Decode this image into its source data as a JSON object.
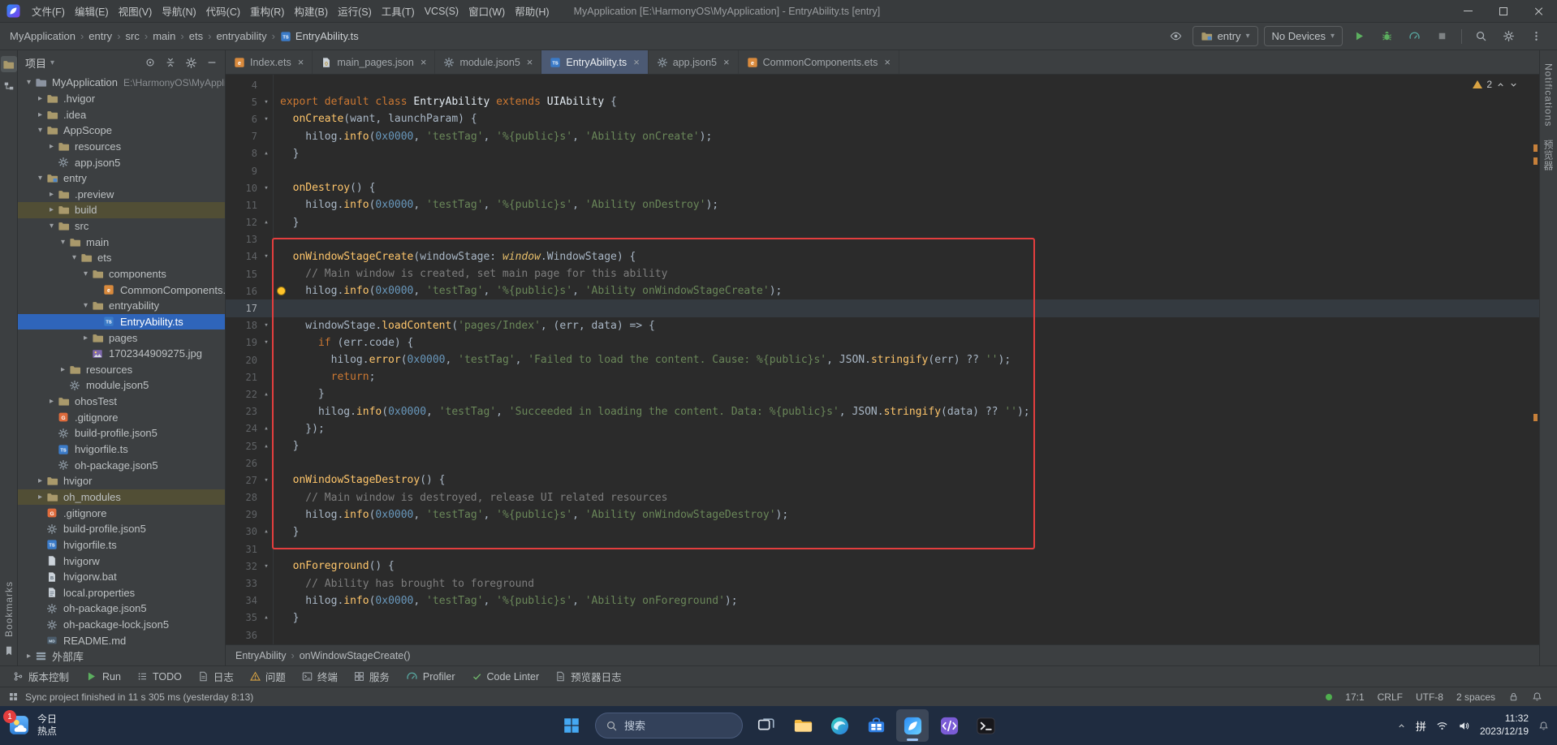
{
  "window": {
    "title": "MyApplication [E:\\HarmonyOS\\MyApplication] - EntryAbility.ts [entry]",
    "menus": [
      "文件(F)",
      "编辑(E)",
      "视图(V)",
      "导航(N)",
      "代码(C)",
      "重构(R)",
      "构建(B)",
      "运行(S)",
      "工具(T)",
      "VCS(S)",
      "窗口(W)",
      "帮助(H)"
    ]
  },
  "toolbar": {
    "breadcrumbs": [
      "MyApplication",
      "entry",
      "src",
      "main",
      "ets",
      "entryability",
      "EntryAbility.ts"
    ],
    "run_config": "entry",
    "device": "No Devices"
  },
  "project_panel": {
    "header": "项目",
    "tree": [
      {
        "level": 0,
        "chevron": "open",
        "icon": "project",
        "label": "MyApplication",
        "hint": "E:\\HarmonyOS\\MyApplicatio"
      },
      {
        "level": 1,
        "chevron": "closed",
        "icon": "folder",
        "label": ".hvigor"
      },
      {
        "level": 1,
        "chevron": "closed",
        "icon": "folder",
        "label": ".idea"
      },
      {
        "level": 1,
        "chevron": "open",
        "icon": "folder",
        "label": "AppScope"
      },
      {
        "level": 2,
        "chevron": "closed",
        "icon": "folder",
        "label": "resources"
      },
      {
        "level": 2,
        "icon": "json5",
        "label": "app.json5"
      },
      {
        "level": 1,
        "chevron": "open",
        "icon": "module",
        "label": "entry"
      },
      {
        "level": 2,
        "chevron": "closed",
        "icon": "folder",
        "label": ".preview"
      },
      {
        "level": 2,
        "chevron": "closed",
        "icon": "folder",
        "label": "build",
        "highlight": true
      },
      {
        "level": 2,
        "chevron": "open",
        "icon": "folder",
        "label": "src"
      },
      {
        "level": 3,
        "chevron": "open",
        "icon": "folder",
        "label": "main"
      },
      {
        "level": 4,
        "chevron": "open",
        "icon": "folder",
        "label": "ets"
      },
      {
        "level": 5,
        "chevron": "open",
        "icon": "folder",
        "label": "components"
      },
      {
        "level": 6,
        "icon": "ets",
        "label": "CommonComponents.ets"
      },
      {
        "level": 5,
        "chevron": "open",
        "icon": "folder",
        "label": "entryability"
      },
      {
        "level": 6,
        "icon": "ts",
        "label": "EntryAbility.ts",
        "selected": true
      },
      {
        "level": 5,
        "chevron": "closed",
        "icon": "folder",
        "label": "pages"
      },
      {
        "level": 5,
        "icon": "img",
        "label": "1702344909275.jpg"
      },
      {
        "level": 3,
        "chevron": "closed",
        "icon": "folder",
        "label": "resources"
      },
      {
        "level": 3,
        "icon": "json5",
        "label": "module.json5"
      },
      {
        "level": 2,
        "chevron": "closed",
        "icon": "folder",
        "label": "ohosTest"
      },
      {
        "level": 2,
        "icon": "git",
        "label": ".gitignore"
      },
      {
        "level": 2,
        "icon": "json5",
        "label": "build-profile.json5"
      },
      {
        "level": 2,
        "icon": "ts",
        "label": "hvigorfile.ts"
      },
      {
        "level": 2,
        "icon": "json5",
        "label": "oh-package.json5"
      },
      {
        "level": 1,
        "chevron": "closed",
        "icon": "folder",
        "label": "hvigor"
      },
      {
        "level": 1,
        "chevron": "closed",
        "icon": "folder",
        "label": "oh_modules",
        "highlight": true
      },
      {
        "level": 1,
        "icon": "git",
        "label": ".gitignore"
      },
      {
        "level": 1,
        "icon": "json5",
        "label": "build-profile.json5"
      },
      {
        "level": 1,
        "icon": "ts",
        "label": "hvigorfile.ts"
      },
      {
        "level": 1,
        "icon": "file",
        "label": "hvigorw"
      },
      {
        "level": 1,
        "icon": "bat",
        "label": "hvigorw.bat"
      },
      {
        "level": 1,
        "icon": "props",
        "label": "local.properties"
      },
      {
        "level": 1,
        "icon": "json5",
        "label": "oh-package.json5"
      },
      {
        "level": 1,
        "icon": "json5",
        "label": "oh-package-lock.json5"
      },
      {
        "level": 1,
        "icon": "md",
        "label": "README.md"
      },
      {
        "level": 0,
        "chevron": "closed",
        "icon": "lib",
        "label": "外部库"
      }
    ]
  },
  "tabs": [
    {
      "label": "Index.ets",
      "icon": "ets"
    },
    {
      "label": "main_pages.json",
      "icon": "json"
    },
    {
      "label": "module.json5",
      "icon": "json5"
    },
    {
      "label": "EntryAbility.ts",
      "icon": "ts",
      "active": true
    },
    {
      "label": "app.json5",
      "icon": "json5"
    },
    {
      "label": "CommonComponents.ets",
      "icon": "ets"
    }
  ],
  "editor": {
    "warning_count": "2",
    "caret_line": 17,
    "bulb_line": 16,
    "highlight_box": {
      "from_line": 14,
      "to_line": 30
    },
    "breadcrumb": [
      "EntryAbility",
      "onWindowStageCreate()"
    ],
    "lines": [
      {
        "n": 4,
        "f": "",
        "t": []
      },
      {
        "n": 5,
        "f": "v",
        "t": [
          [
            "kw",
            "export default class "
          ],
          [
            "cls",
            "EntryAbility "
          ],
          [
            "kw",
            "extends "
          ],
          [
            "cls",
            "UIAbility "
          ],
          [
            "p",
            "{"
          ]
        ]
      },
      {
        "n": 6,
        "f": "v",
        "t": [
          [
            "p",
            "  "
          ],
          [
            "fn",
            "onCreate"
          ],
          [
            "p",
            "(want, launchParam) {"
          ]
        ]
      },
      {
        "n": 7,
        "f": "",
        "t": [
          [
            "p",
            "    hilog."
          ],
          [
            "fn",
            "info"
          ],
          [
            "p",
            "("
          ],
          [
            "num",
            "0x0000"
          ],
          [
            "p",
            ", "
          ],
          [
            "str",
            "'testTag'"
          ],
          [
            "p",
            ", "
          ],
          [
            "str",
            "'%{public}s'"
          ],
          [
            "p",
            ", "
          ],
          [
            "str",
            "'Ability onCreate'"
          ],
          [
            "p",
            ");"
          ]
        ]
      },
      {
        "n": 8,
        "f": "^",
        "t": [
          [
            "p",
            "  }"
          ]
        ]
      },
      {
        "n": 9,
        "f": "",
        "t": []
      },
      {
        "n": 10,
        "f": "v",
        "t": [
          [
            "p",
            "  "
          ],
          [
            "fn",
            "onDestroy"
          ],
          [
            "p",
            "() {"
          ]
        ]
      },
      {
        "n": 11,
        "f": "",
        "t": [
          [
            "p",
            "    hilog."
          ],
          [
            "fn",
            "info"
          ],
          [
            "p",
            "("
          ],
          [
            "num",
            "0x0000"
          ],
          [
            "p",
            ", "
          ],
          [
            "str",
            "'testTag'"
          ],
          [
            "p",
            ", "
          ],
          [
            "str",
            "'%{public}s'"
          ],
          [
            "p",
            ", "
          ],
          [
            "str",
            "'Ability onDestroy'"
          ],
          [
            "p",
            ");"
          ]
        ]
      },
      {
        "n": 12,
        "f": "^",
        "t": [
          [
            "p",
            "  }"
          ]
        ]
      },
      {
        "n": 13,
        "f": "",
        "t": []
      },
      {
        "n": 14,
        "f": "v",
        "t": [
          [
            "p",
            "  "
          ],
          [
            "fn",
            "onWindowStageCreate"
          ],
          [
            "p",
            "(windowStage: "
          ],
          [
            "glob",
            "window"
          ],
          [
            "p",
            ".WindowStage) {"
          ]
        ]
      },
      {
        "n": 15,
        "f": "",
        "t": [
          [
            "cmt",
            "    // Main window is created, set main page for this ability"
          ]
        ]
      },
      {
        "n": 16,
        "f": "",
        "t": [
          [
            "p",
            "    hilog."
          ],
          [
            "fn",
            "info"
          ],
          [
            "p",
            "("
          ],
          [
            "num",
            "0x0000"
          ],
          [
            "p",
            ", "
          ],
          [
            "str",
            "'testTag'"
          ],
          [
            "p",
            ", "
          ],
          [
            "str",
            "'%{public}s'"
          ],
          [
            "p",
            ", "
          ],
          [
            "str",
            "'Ability onWindowStageCreate'"
          ],
          [
            "p",
            ");"
          ]
        ]
      },
      {
        "n": 17,
        "f": "",
        "t": []
      },
      {
        "n": 18,
        "f": "v",
        "t": [
          [
            "p",
            "    windowStage."
          ],
          [
            "fn",
            "loadContent"
          ],
          [
            "p",
            "("
          ],
          [
            "str",
            "'pages/Index'"
          ],
          [
            "p",
            ", (err, data) => {"
          ]
        ]
      },
      {
        "n": 19,
        "f": "v",
        "t": [
          [
            "p",
            "      "
          ],
          [
            "kw",
            "if"
          ],
          [
            "p",
            " (err.code) {"
          ]
        ]
      },
      {
        "n": 20,
        "f": "",
        "t": [
          [
            "p",
            "        hilog."
          ],
          [
            "fn",
            "error"
          ],
          [
            "p",
            "("
          ],
          [
            "num",
            "0x0000"
          ],
          [
            "p",
            ", "
          ],
          [
            "str",
            "'testTag'"
          ],
          [
            "p",
            ", "
          ],
          [
            "str",
            "'Failed to load the content. Cause: %{public}s'"
          ],
          [
            "p",
            ", JSON."
          ],
          [
            "fn",
            "stringify"
          ],
          [
            "p",
            "(err) ?? "
          ],
          [
            "str",
            "''"
          ],
          [
            "p",
            ");"
          ]
        ]
      },
      {
        "n": 21,
        "f": "",
        "t": [
          [
            "p",
            "        "
          ],
          [
            "kw",
            "return"
          ],
          [
            "p",
            ";"
          ]
        ]
      },
      {
        "n": 22,
        "f": "^",
        "t": [
          [
            "p",
            "      }"
          ]
        ]
      },
      {
        "n": 23,
        "f": "",
        "t": [
          [
            "p",
            "      hilog."
          ],
          [
            "fn",
            "info"
          ],
          [
            "p",
            "("
          ],
          [
            "num",
            "0x0000"
          ],
          [
            "p",
            ", "
          ],
          [
            "str",
            "'testTag'"
          ],
          [
            "p",
            ", "
          ],
          [
            "str",
            "'Succeeded in loading the content. Data: %{public}s'"
          ],
          [
            "p",
            ", JSON."
          ],
          [
            "fn",
            "stringify"
          ],
          [
            "p",
            "(data) ?? "
          ],
          [
            "str",
            "''"
          ],
          [
            "p",
            ");"
          ]
        ]
      },
      {
        "n": 24,
        "f": "^",
        "t": [
          [
            "p",
            "    });"
          ]
        ]
      },
      {
        "n": 25,
        "f": "^",
        "t": [
          [
            "p",
            "  }"
          ]
        ]
      },
      {
        "n": 26,
        "f": "",
        "t": []
      },
      {
        "n": 27,
        "f": "v",
        "t": [
          [
            "p",
            "  "
          ],
          [
            "fn",
            "onWindowStageDestroy"
          ],
          [
            "p",
            "() {"
          ]
        ]
      },
      {
        "n": 28,
        "f": "",
        "t": [
          [
            "cmt",
            "    // Main window is destroyed, release UI related resources"
          ]
        ]
      },
      {
        "n": 29,
        "f": "",
        "t": [
          [
            "p",
            "    hilog."
          ],
          [
            "fn",
            "info"
          ],
          [
            "p",
            "("
          ],
          [
            "num",
            "0x0000"
          ],
          [
            "p",
            ", "
          ],
          [
            "str",
            "'testTag'"
          ],
          [
            "p",
            ", "
          ],
          [
            "str",
            "'%{public}s'"
          ],
          [
            "p",
            ", "
          ],
          [
            "str",
            "'Ability onWindowStageDestroy'"
          ],
          [
            "p",
            ");"
          ]
        ]
      },
      {
        "n": 30,
        "f": "^",
        "t": [
          [
            "p",
            "  }"
          ]
        ]
      },
      {
        "n": 31,
        "f": "",
        "t": []
      },
      {
        "n": 32,
        "f": "v",
        "t": [
          [
            "p",
            "  "
          ],
          [
            "fn",
            "onForeground"
          ],
          [
            "p",
            "() {"
          ]
        ]
      },
      {
        "n": 33,
        "f": "",
        "t": [
          [
            "cmt",
            "    // Ability has brought to foreground"
          ]
        ]
      },
      {
        "n": 34,
        "f": "",
        "t": [
          [
            "p",
            "    hilog."
          ],
          [
            "fn",
            "info"
          ],
          [
            "p",
            "("
          ],
          [
            "num",
            "0x0000"
          ],
          [
            "p",
            ", "
          ],
          [
            "str",
            "'testTag'"
          ],
          [
            "p",
            ", "
          ],
          [
            "str",
            "'%{public}s'"
          ],
          [
            "p",
            ", "
          ],
          [
            "str",
            "'Ability onForeground'"
          ],
          [
            "p",
            ");"
          ]
        ]
      },
      {
        "n": 35,
        "f": "^",
        "t": [
          [
            "p",
            "  }"
          ]
        ]
      },
      {
        "n": 36,
        "f": "",
        "t": []
      }
    ]
  },
  "bottom_bar": [
    {
      "icon": "branch",
      "label": "版本控制"
    },
    {
      "icon": "play",
      "label": "Run"
    },
    {
      "icon": "todo",
      "label": "TODO"
    },
    {
      "icon": "log",
      "label": "日志"
    },
    {
      "icon": "warn",
      "label": "问题"
    },
    {
      "icon": "terminal",
      "label": "终端"
    },
    {
      "icon": "services",
      "label": "服务"
    },
    {
      "icon": "gauge",
      "label": "Profiler"
    },
    {
      "icon": "check",
      "label": "Code Linter"
    },
    {
      "icon": "log",
      "label": "预览器日志"
    }
  ],
  "status_bar": {
    "message": "Sync project finished in 11 s 305 ms (yesterday 8:13)",
    "caret_position": "17:1",
    "line_separator": "CRLF",
    "encoding": "UTF-8",
    "indent": "2 spaces"
  },
  "side_strips": {
    "right_top_label": "Notifications",
    "right_second_label": "预览器",
    "left_bottom_label": "Bookmarks"
  },
  "taskbar": {
    "widget": {
      "badge": "1",
      "line1": "今日",
      "line2": "热点"
    },
    "search_placeholder": "搜索",
    "apps": [
      {
        "name": "task-view"
      },
      {
        "name": "file-explorer"
      },
      {
        "name": "edge"
      },
      {
        "name": "store"
      },
      {
        "name": "deveco-studio",
        "active": true
      },
      {
        "name": "dev-tool"
      },
      {
        "name": "terminal"
      }
    ],
    "tray": {
      "ime": "拼",
      "time": "11:32",
      "date": "2023/12/19"
    }
  }
}
